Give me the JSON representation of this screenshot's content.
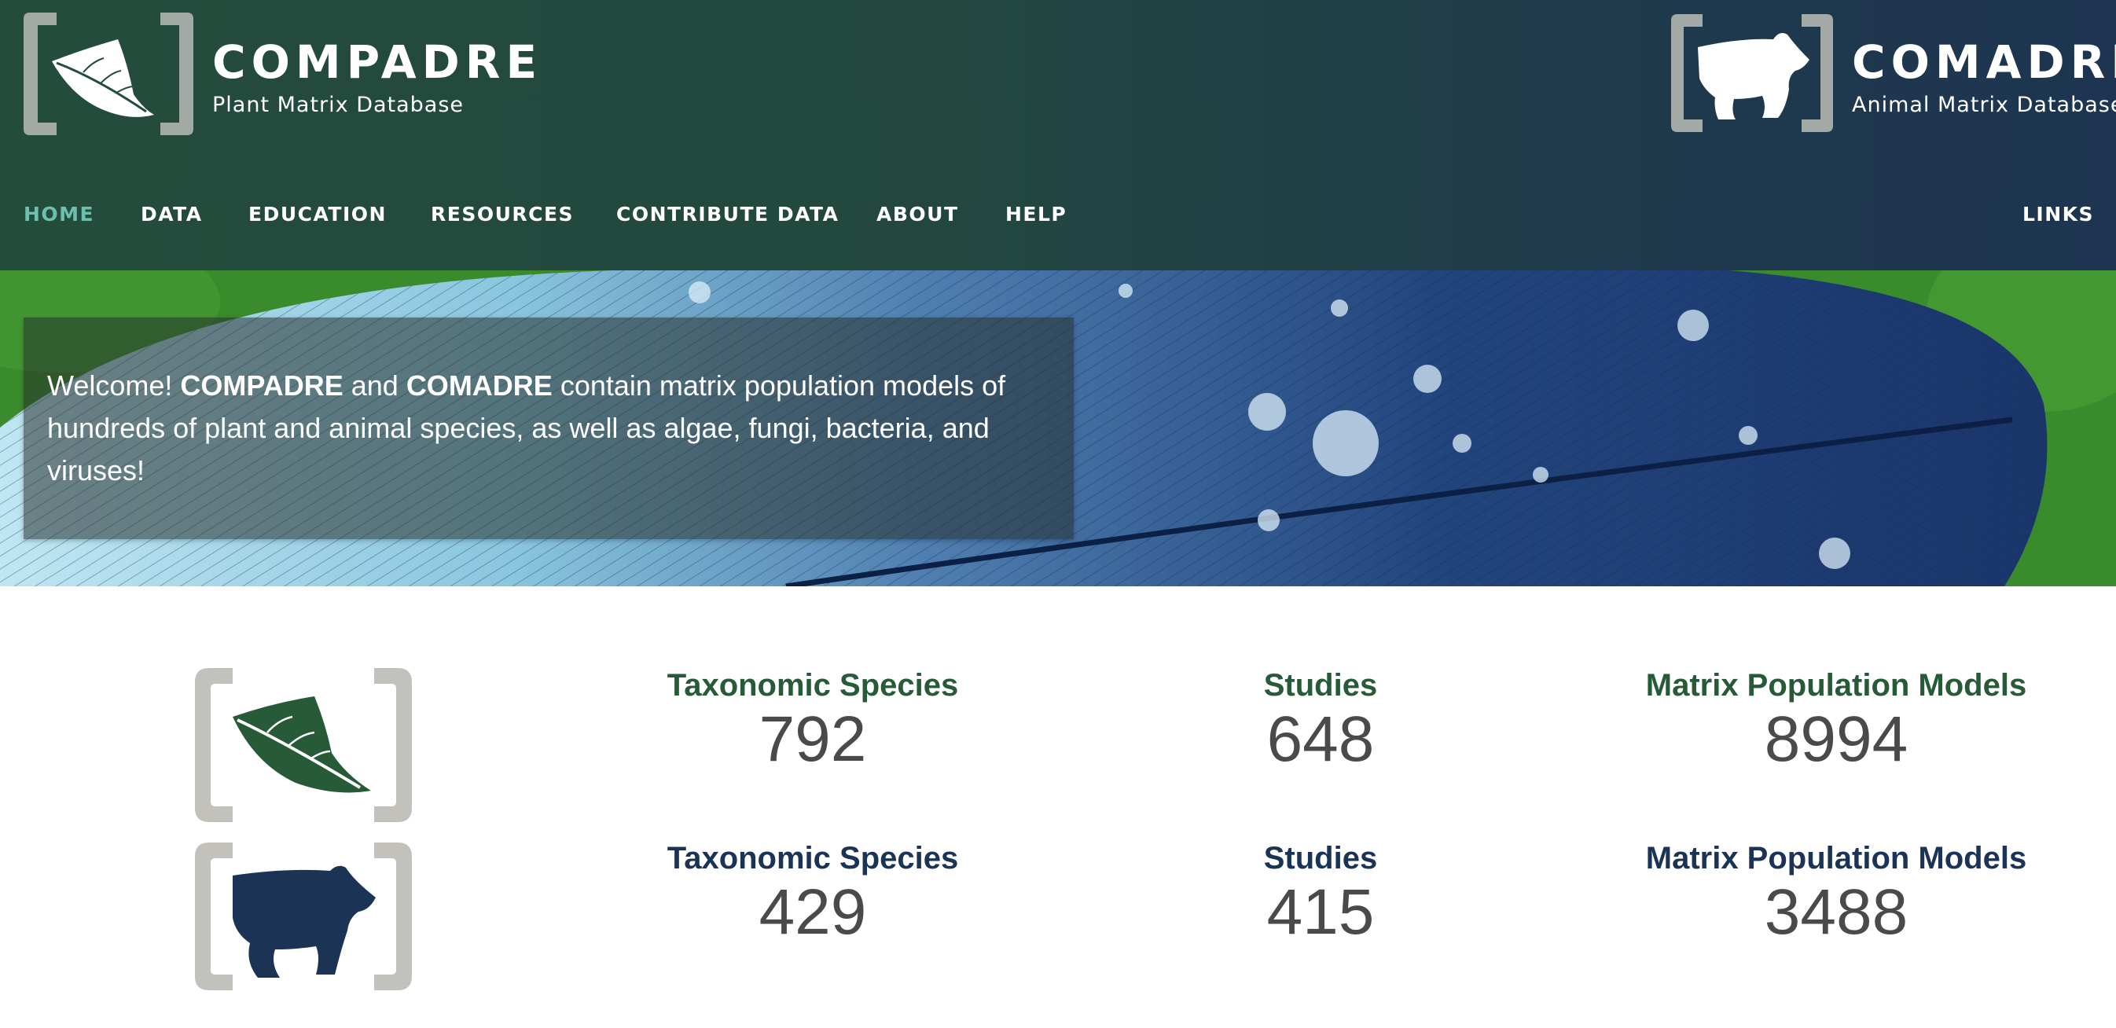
{
  "brand_left": {
    "name": "COMPADRE",
    "subtitle": "Plant Matrix Database",
    "icon": "leaf-icon"
  },
  "brand_right": {
    "name": "COMADRE",
    "subtitle": "Animal Matrix Database",
    "icon": "bear-icon"
  },
  "nav": {
    "items": [
      {
        "label": "HOME",
        "active": true
      },
      {
        "label": "DATA"
      },
      {
        "label": "EDUCATION"
      },
      {
        "label": "RESOURCES"
      },
      {
        "label": "CONTRIBUTE DATA"
      },
      {
        "label": "ABOUT"
      },
      {
        "label": "HELP"
      }
    ],
    "links_label": "LINKS"
  },
  "welcome": {
    "prefix": "Welcome! ",
    "name1": "COMPADRE",
    "and": " and ",
    "name2": "COMADRE",
    "rest": " contain matrix population models of hundreds of plant and animal species, as well as algae, fungi, bacteria, and viruses!"
  },
  "stats": {
    "plants": {
      "icon": "leaf-icon",
      "species_label": "Taxonomic Species",
      "species": "792",
      "studies_label": "Studies",
      "studies": "648",
      "models_label": "Matrix Population Models",
      "models": "8994"
    },
    "animals": {
      "icon": "bear-icon",
      "species_label": "Taxonomic Species",
      "species": "429",
      "studies_label": "Studies",
      "studies": "415",
      "models_label": "Matrix Population Models",
      "models": "3488"
    }
  },
  "colors": {
    "header_green": "#244c3c",
    "header_blue": "#1d3550",
    "nav_active": "#6dbfae",
    "plant_green": "#275b38",
    "animal_navy": "#1b3456",
    "bracket_gray": "#c2c1bc",
    "number_gray": "#4a4a4a"
  }
}
